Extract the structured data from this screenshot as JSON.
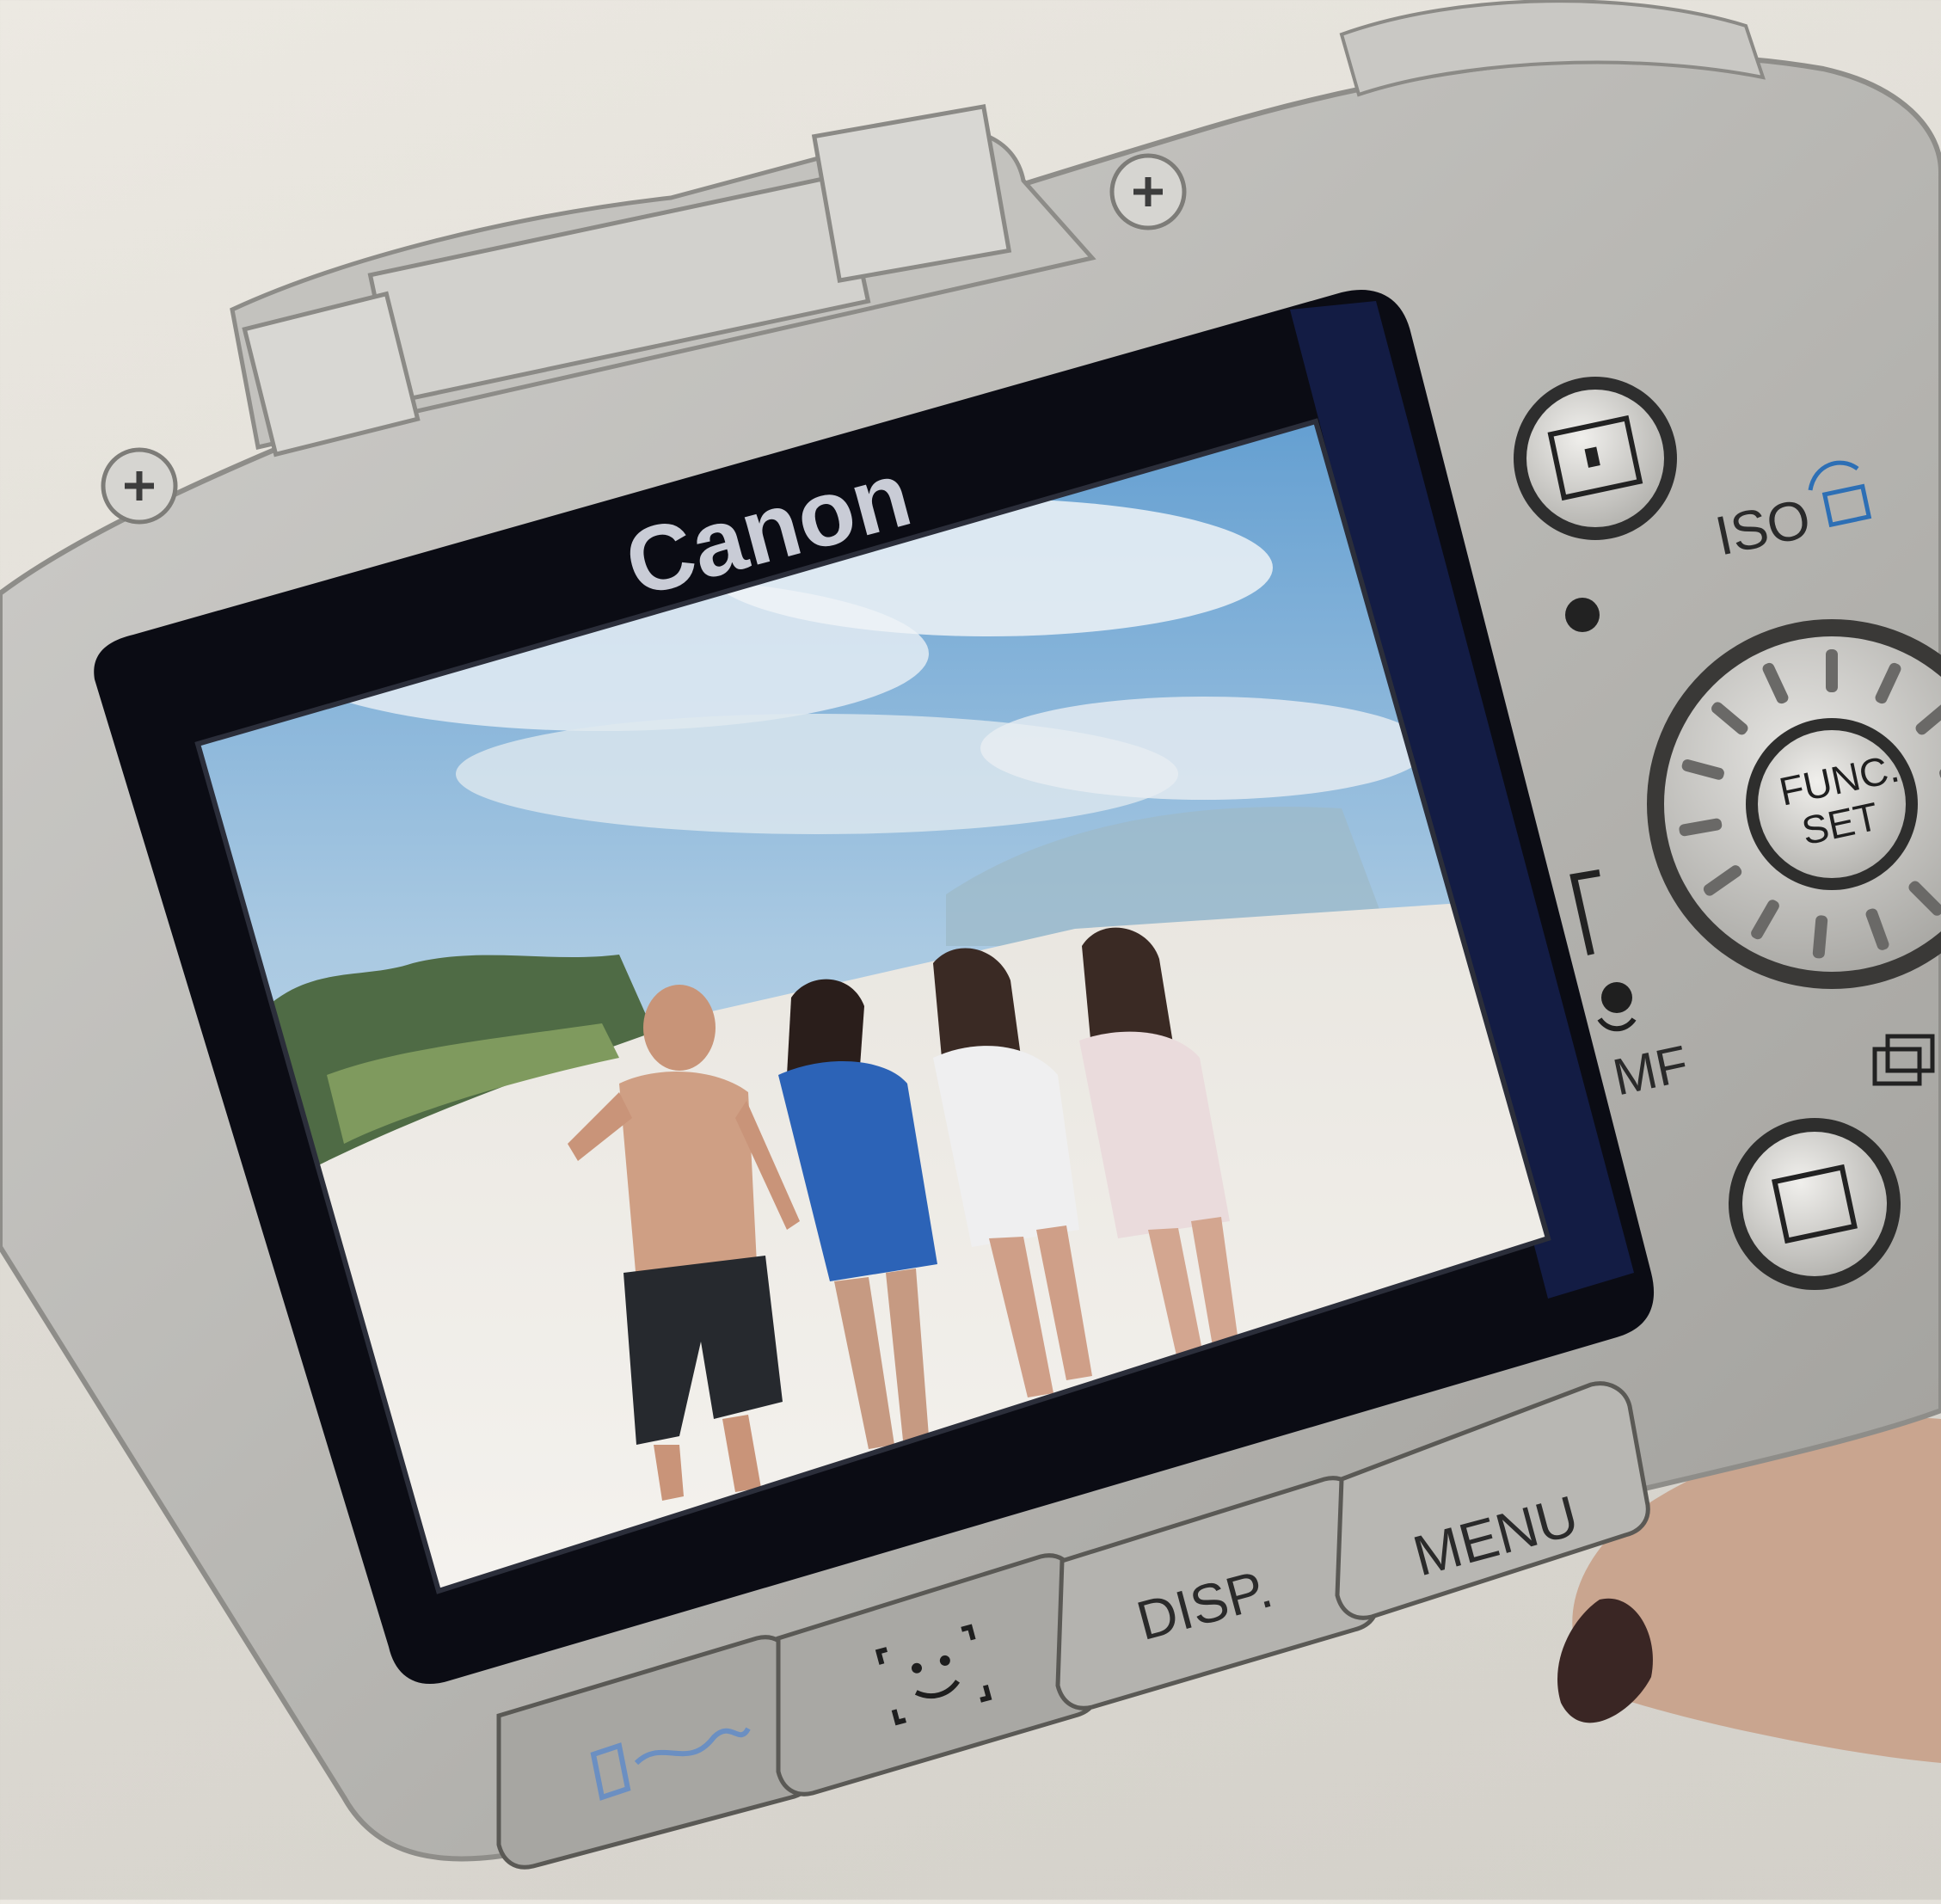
{
  "camera": {
    "brand": "Canon",
    "labels": {
      "iso": "ISO",
      "func": "FUNC.",
      "set": "SET",
      "mf": "MF",
      "disp": "DISP.",
      "menu": "MENU"
    }
  },
  "colors": {
    "body": "#b9b8b4",
    "lcd_bezel": "#0b0c14",
    "sky": "#7fb3d8",
    "sand": "#ece9e3"
  },
  "icons": [
    "screw-icon",
    "print-share-icon",
    "face-detect-icon",
    "playback-icon",
    "shooting-mode-icon",
    "macro-icon",
    "continuous-shot-icon",
    "rotate-icon"
  ]
}
